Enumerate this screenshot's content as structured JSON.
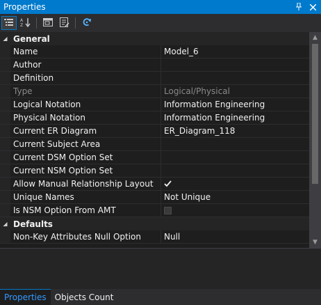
{
  "window": {
    "title": "Properties"
  },
  "title_icons": {
    "pin": "pin-icon",
    "close": "close-icon"
  },
  "toolbar": {
    "buttons": [
      {
        "icon": "categorized-icon",
        "active": true
      },
      {
        "icon": "alphabetical-icon",
        "active": false
      },
      {
        "icon": "property-pages-icon",
        "active": false
      },
      {
        "icon": "properties-icon",
        "active": false
      },
      {
        "icon": "refresh-icon",
        "active": false
      }
    ]
  },
  "general": {
    "label": "General",
    "rows": {
      "name": {
        "label": "Name",
        "value": "Model_6"
      },
      "author": {
        "label": "Author",
        "value": ""
      },
      "definition": {
        "label": "Definition",
        "value": ""
      },
      "type": {
        "label": "Type",
        "value": "Logical/Physical"
      },
      "logical_notation": {
        "label": "Logical Notation",
        "value": "Information Engineering"
      },
      "physical_notation": {
        "label": "Physical Notation",
        "value": "Information Engineering"
      },
      "current_er_diagram": {
        "label": "Current ER Diagram",
        "value": "ER_Diagram_118"
      },
      "current_subject_area": {
        "label": "Current Subject Area",
        "value": ""
      },
      "current_dsm_option_set": {
        "label": "Current DSM Option Set",
        "value": ""
      },
      "current_nsm_option_set": {
        "label": "Current NSM Option Set",
        "value": ""
      },
      "allow_manual_relationship_layout": {
        "label": "Allow Manual Relationship Layout",
        "checked": true
      },
      "unique_names": {
        "label": "Unique Names",
        "value": "Not Unique"
      },
      "is_nsm_option_from_amt": {
        "label": "Is NSM Option From AMT",
        "checked": false
      }
    }
  },
  "defaults": {
    "label": "Defaults",
    "rows": {
      "non_key_attributes_null_option": {
        "label": "Non-Key Attributes Null Option",
        "value": "Null"
      }
    }
  },
  "tabs": {
    "properties": "Properties",
    "objects_count": "Objects Count"
  },
  "colors": {
    "accent": "#007acc",
    "background": "#1e1e1e",
    "tab_active_text": "#3399ff"
  }
}
